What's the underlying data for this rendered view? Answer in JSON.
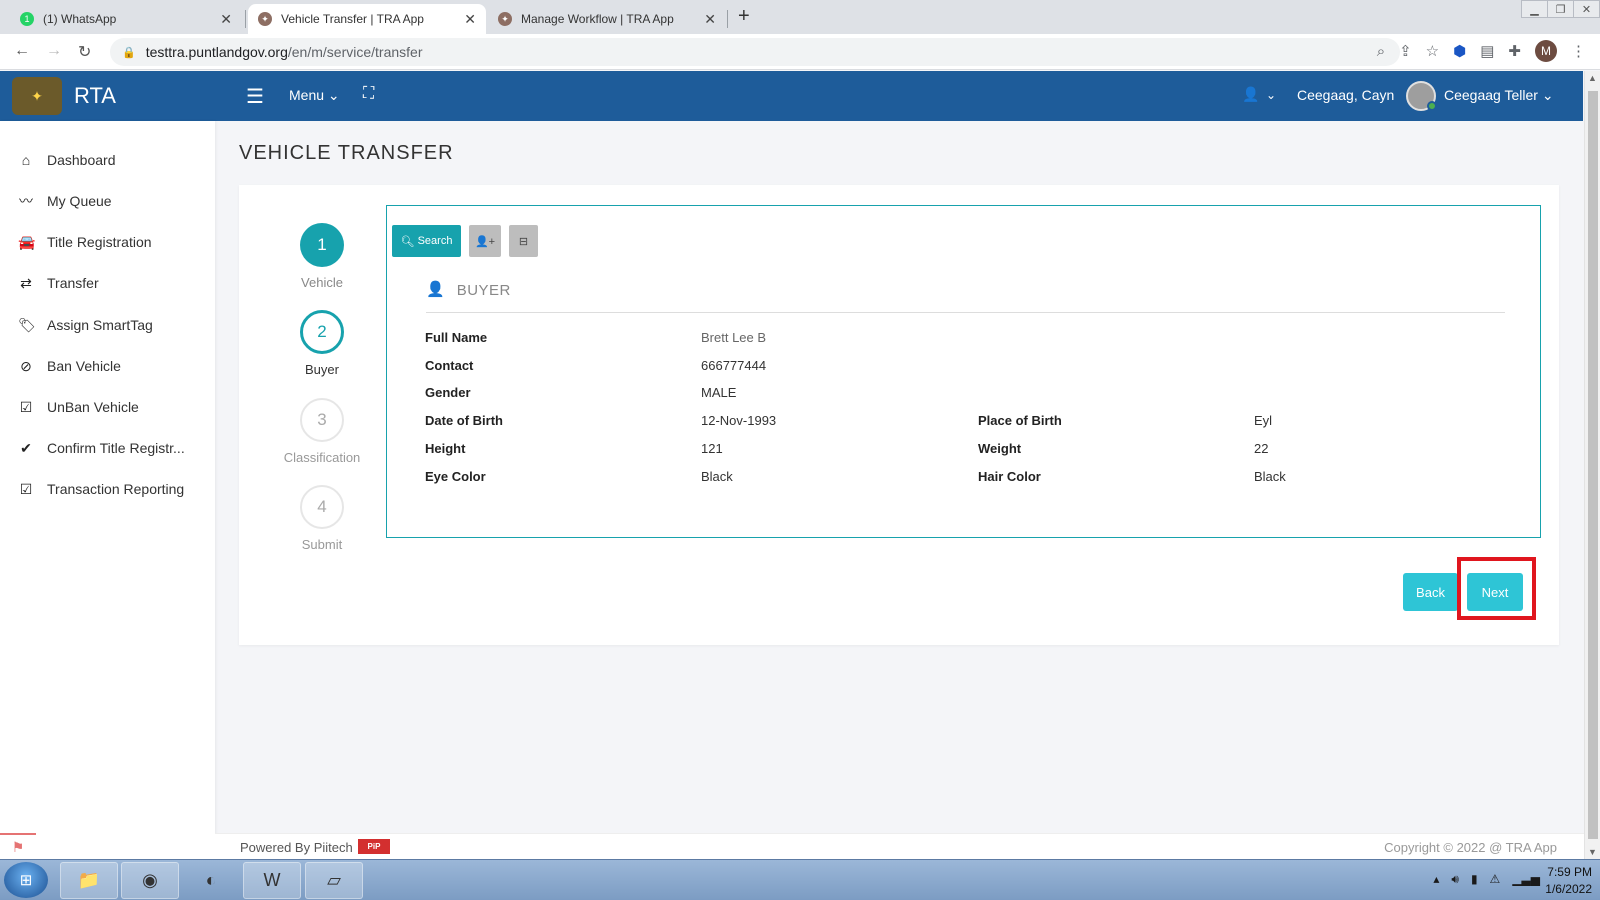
{
  "browser": {
    "tabs": [
      {
        "title": "(1) WhatsApp",
        "active": false
      },
      {
        "title": "Vehicle Transfer | TRA App",
        "active": true
      },
      {
        "title": "Manage Workflow | TRA App",
        "active": false
      }
    ],
    "url_host": "testtra.puntlandgov.org",
    "url_path": "/en/m/service/transfer",
    "profile_initial": "M"
  },
  "header": {
    "brand": "RTA",
    "menu_label": "Menu",
    "user_name": "Ceegaag, Cayn",
    "teller_name": "Ceegaag Teller"
  },
  "sidebar": {
    "items": [
      {
        "label": "Dashboard",
        "icon": "home-icon"
      },
      {
        "label": "My Queue",
        "icon": "trend-icon"
      },
      {
        "label": "Title Registration",
        "icon": "car-icon"
      },
      {
        "label": "Transfer",
        "icon": "exchange-icon"
      },
      {
        "label": "Assign SmartTag",
        "icon": "tags-icon"
      },
      {
        "label": "Ban Vehicle",
        "icon": "ban-icon"
      },
      {
        "label": "UnBan Vehicle",
        "icon": "check-square-icon"
      },
      {
        "label": "Confirm Title Registr...",
        "icon": "check-icon"
      },
      {
        "label": "Transaction Reporting",
        "icon": "check-square-icon"
      }
    ]
  },
  "page": {
    "title": "VEHICLE TRANSFER"
  },
  "steps": [
    {
      "num": "1",
      "label": "Vehicle",
      "state": "done"
    },
    {
      "num": "2",
      "label": "Buyer",
      "state": "current"
    },
    {
      "num": "3",
      "label": "Classification",
      "state": "pending"
    },
    {
      "num": "4",
      "label": "Submit",
      "state": "pending"
    }
  ],
  "toolbar": {
    "search_label": "Search"
  },
  "buyer": {
    "section_title": "BUYER",
    "full_name_label": "Full Name",
    "full_name": "Brett Lee B",
    "contact_label": "Contact",
    "contact": "666777444",
    "gender_label": "Gender",
    "gender": "MALE",
    "dob_label": "Date of Birth",
    "dob": "12-Nov-1993",
    "pob_label": "Place of Birth",
    "pob": "Eyl",
    "height_label": "Height",
    "height": "121",
    "weight_label": "Weight",
    "weight": "22",
    "eye_label": "Eye Color",
    "eye": "Black",
    "hair_label": "Hair Color",
    "hair": "Black"
  },
  "actions": {
    "back_label": "Back",
    "next_label": "Next"
  },
  "footer": {
    "powered": "Powered By Piitech",
    "logo_text": "PiP",
    "copyright": "Copyright © 2022 @ TRA App"
  },
  "taskbar": {
    "time": "7:59 PM",
    "date": "1/6/2022"
  },
  "colors": {
    "header_bg": "#1e5c9a",
    "accent_teal": "#17a2ad",
    "button_cyan": "#2ec5d6",
    "highlight_red": "#e0161e"
  }
}
